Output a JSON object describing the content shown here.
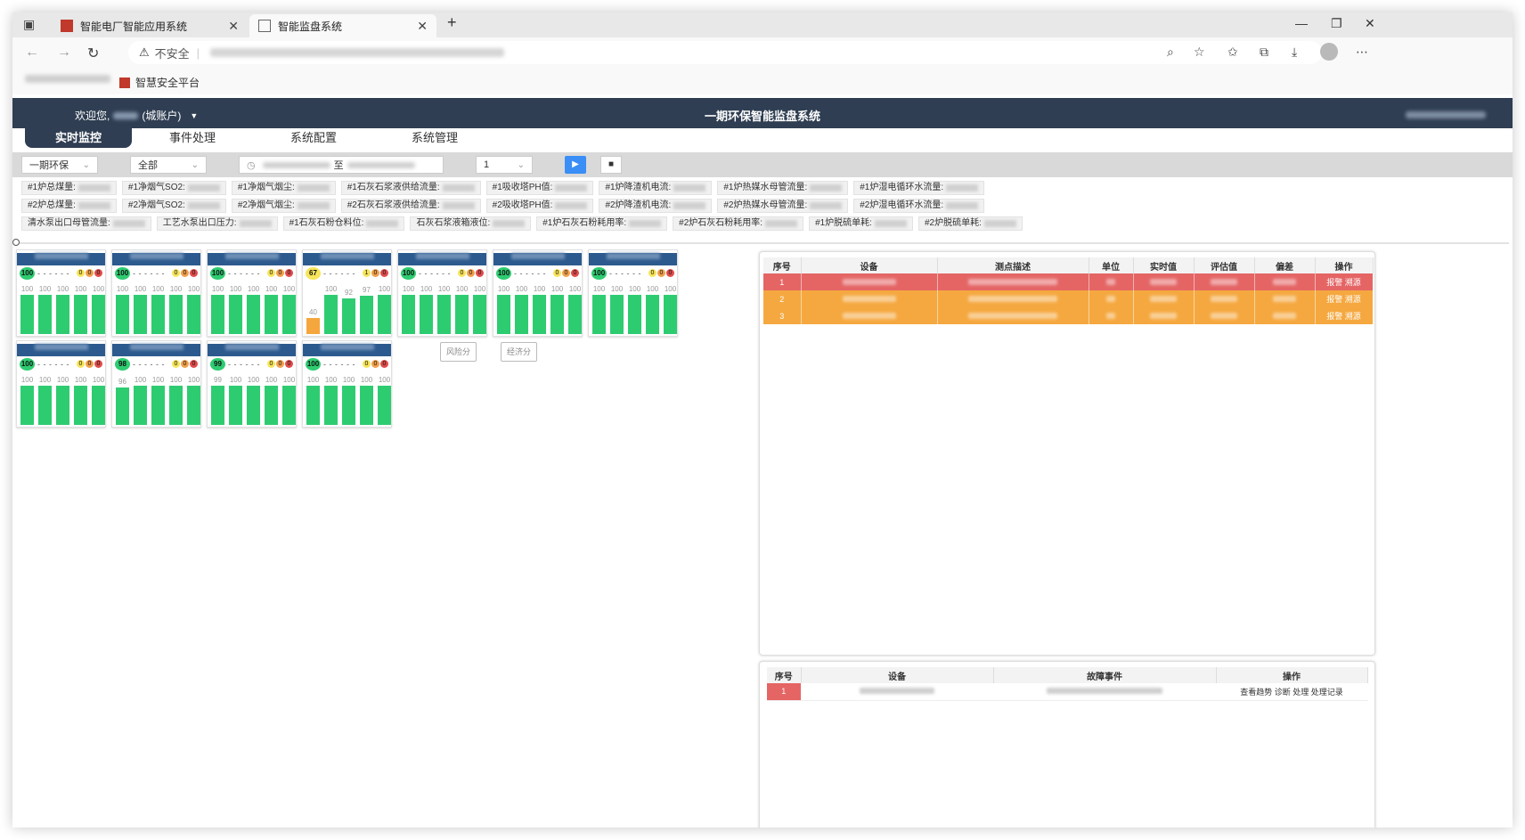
{
  "browser": {
    "tabs": [
      {
        "label": "智能电厂智能应用系统",
        "active": false
      },
      {
        "label": "智能监盘系统",
        "active": true
      }
    ],
    "new_tab": "+",
    "window_controls": [
      "—",
      "❐",
      "✕"
    ],
    "security_label": "不安全",
    "favorites": [
      {
        "label": "智慧安全平台"
      }
    ]
  },
  "app": {
    "welcome_prefix": "欢迎您,",
    "account_type": "(城账户)",
    "title": "一期环保智能监盘系统",
    "menu": [
      "实时监控",
      "事件处理",
      "系统配置",
      "系统管理"
    ],
    "active_menu": 0
  },
  "filters": {
    "system": "一期环保",
    "scope": "全部",
    "range_sep": "至",
    "speed": "1"
  },
  "metrics": {
    "row1": [
      "#1炉总煤量:",
      "#1净烟气SO2:",
      "#1净烟气烟尘:",
      "#1石灰石浆液供给流量:",
      "#1吸收塔PH值:",
      "#1炉降渣机电流:",
      "#1炉热媒水母管流量:",
      "#1炉湿电循环水流量:"
    ],
    "row2": [
      "#2炉总煤量:",
      "#2净烟气SO2:",
      "#2净烟气烟尘:",
      "#2石灰石浆液供给流量:",
      "#2吸收塔PH值:",
      "#2炉降渣机电流:",
      "#2炉热媒水母管流量:",
      "#2炉湿电循环水流量:"
    ],
    "row3": [
      "清水泵出口母管流量:",
      "工艺水泵出口压力:",
      "#1石灰石粉仓料位:",
      "石灰石浆液箱液位:",
      "#1炉石灰石粉耗用率:",
      "#2炉石灰石粉耗用率:",
      "#1炉脱硫单耗:",
      "#2炉脱硫单耗:"
    ]
  },
  "cards": [
    {
      "score": "100",
      "dash": "- - - - - -",
      "counts": [
        "0",
        "0",
        "0"
      ],
      "bars": [
        "100",
        "100",
        "100",
        "100",
        "100"
      ],
      "score_color": "green"
    },
    {
      "score": "100",
      "dash": "- - - - - -",
      "counts": [
        "0",
        "0",
        "0"
      ],
      "bars": [
        "100",
        "100",
        "100",
        "100",
        "100"
      ],
      "score_color": "green"
    },
    {
      "score": "100",
      "dash": "- - - - - -",
      "counts": [
        "0",
        "0",
        "0"
      ],
      "bars": [
        "100",
        "100",
        "100",
        "100",
        "100"
      ],
      "score_color": "green"
    },
    {
      "score": "67",
      "dash": "- - - - - -",
      "counts": [
        "1",
        "0",
        "0"
      ],
      "bars": [
        "40",
        "100",
        "92",
        "97",
        "100"
      ],
      "score_color": "yellow"
    },
    {
      "score": "100",
      "dash": "- - - - - -",
      "counts": [
        "0",
        "0",
        "0"
      ],
      "bars": [
        "100",
        "100",
        "100",
        "100",
        "100"
      ],
      "score_color": "green"
    },
    {
      "score": "100",
      "dash": "- - - - - -",
      "counts": [
        "0",
        "0",
        "0"
      ],
      "bars": [
        "100",
        "100",
        "100",
        "100",
        "100"
      ],
      "score_color": "green"
    },
    {
      "score": "100",
      "dash": "- - - - - -",
      "counts": [
        "0",
        "0",
        "0"
      ],
      "bars": [
        "100",
        "100",
        "100",
        "100",
        "100"
      ],
      "score_color": "green"
    },
    {
      "score": "100",
      "dash": "- - - - - -",
      "counts": [
        "0",
        "0",
        "0"
      ],
      "bars": [
        "100",
        "100",
        "100",
        "100",
        "100"
      ],
      "score_color": "green"
    },
    {
      "score": "98",
      "dash": "- - - - - -",
      "counts": [
        "0",
        "0",
        "0"
      ],
      "bars": [
        "96",
        "100",
        "100",
        "100",
        "100"
      ],
      "score_color": "green"
    },
    {
      "score": "99",
      "dash": "- - - - - -",
      "counts": [
        "0",
        "0",
        "0"
      ],
      "bars": [
        "99",
        "100",
        "100",
        "100",
        "100"
      ],
      "score_color": "green"
    },
    {
      "score": "100",
      "dash": "- - - - - -",
      "counts": [
        "0",
        "0",
        "0"
      ],
      "bars": [
        "100",
        "100",
        "100",
        "100",
        "100"
      ],
      "score_color": "green"
    }
  ],
  "tooltips": [
    "风险分",
    "经济分"
  ],
  "alarm_table": {
    "headers": [
      "序号",
      "设备",
      "测点描述",
      "单位",
      "实时值",
      "评估值",
      "偏差",
      "操作"
    ],
    "rows": [
      {
        "no": "1",
        "level": "red",
        "ops": "报警 溯源"
      },
      {
        "no": "2",
        "level": "orange",
        "ops": "报警 溯源"
      },
      {
        "no": "3",
        "level": "orange",
        "ops": "报警 溯源"
      }
    ]
  },
  "fault_table": {
    "headers": [
      "序号",
      "设备",
      "故障事件",
      "操作"
    ],
    "rows": [
      {
        "no": "1",
        "ops": "查看趋势  诊断  处理  处理记录"
      }
    ]
  },
  "colors": {
    "header_bg": "#2f3e52",
    "card_head": "#2c5a8e",
    "green": "#2ecc71",
    "orange": "#f5a63c",
    "red": "#e56565",
    "play_blue": "#3a8ef5"
  }
}
